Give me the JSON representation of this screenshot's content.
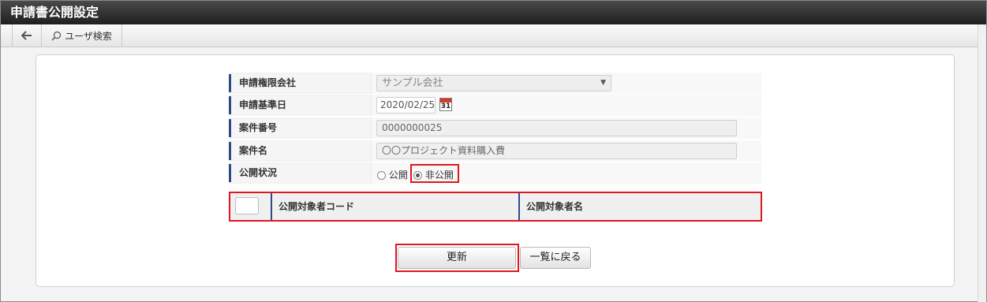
{
  "window": {
    "title": "申請書公開設定"
  },
  "toolbar": {
    "back_icon": "arrow-left-icon",
    "search_icon": "search-icon",
    "search_label": "ユーザ検索"
  },
  "form": {
    "company": {
      "label": "申請権限会社",
      "value": "サンプル会社"
    },
    "base_date": {
      "label": "申請基準日",
      "value": "2020/02/25",
      "calendar_day": "31"
    },
    "case_number": {
      "label": "案件番号",
      "value": "0000000025"
    },
    "case_name": {
      "label": "案件名",
      "value": "〇〇プロジェクト資料購入費"
    },
    "visibility": {
      "label": "公開状況",
      "options": [
        {
          "label": "公開",
          "selected": false
        },
        {
          "label": "非公開",
          "selected": true
        }
      ]
    }
  },
  "target_table": {
    "columns": [
      "公開対象者コード",
      "公開対象者名"
    ]
  },
  "buttons": {
    "update": "更新",
    "back_to_list": "一覧に戻る"
  },
  "colors": {
    "highlight": "#e0161e",
    "label_accent": "#2e4a86",
    "titlebar": "#2a2a2a"
  }
}
